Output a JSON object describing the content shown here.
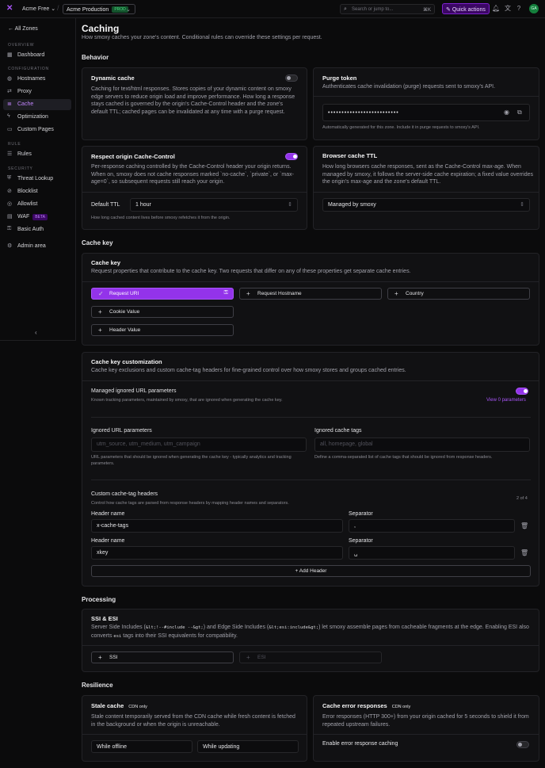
{
  "topbar": {
    "account": "Acme Free",
    "zone": "Acme Production",
    "zone_badge": "PROD",
    "search_placeholder": "Search or jump to...",
    "search_kbd": "⌘K",
    "quick_actions": "Quick actions",
    "avatar": "GA"
  },
  "sidebar": {
    "back": "All Zones",
    "sections": {
      "overview": "OVERVIEW",
      "configuration": "CONFIGURATION",
      "rule": "RULE",
      "security": "SECURITY"
    },
    "items": {
      "dashboard": "Dashboard",
      "hostnames": "Hostnames",
      "proxy": "Proxy",
      "cache": "Cache",
      "optimization": "Optimization",
      "custom_pages": "Custom Pages",
      "rules": "Rules",
      "threat_lookup": "Threat Lookup",
      "blocklist": "Blocklist",
      "allowlist": "Allowlist",
      "waf": "WAF",
      "waf_badge": "BETA",
      "basic_auth": "Basic Auth",
      "admin_area": "Admin area"
    }
  },
  "page": {
    "title": "Caching",
    "subtitle": "How smoxy caches your zone's content. Conditional rules can override these settings per request."
  },
  "behavior": {
    "heading": "Behavior",
    "dynamic": {
      "title": "Dynamic cache",
      "desc": "Caching for text/html responses. Stores copies of your dynamic content on smoxy edge servers to reduce origin load and improve performance. How long a response stays cached is governed by the origin's Cache-Control header and the zone's default TTL; cached pages can be invalidated at any time with a purge request.",
      "enabled": false
    },
    "purge": {
      "title": "Purge token",
      "desc": "Authenticates cache invalidation (purge) requests sent to smoxy's API.",
      "value": "••••••••••••••••••••••••••",
      "help": "Automatically generated for this zone. Include it in purge requests to smoxy's API."
    },
    "origin_cc": {
      "title": "Respect origin Cache-Control",
      "desc": "Per-response caching controlled by the Cache-Control header your origin returns. When on, smoxy does not cache responses marked `no-cache`, `private`, or `max-age=0`, so subsequent requests still reach your origin.",
      "enabled": true,
      "ttl_label": "Default TTL",
      "ttl_value": "1 hour",
      "ttl_help": "How long cached content lives before smoxy refetches it from the origin."
    },
    "browser_ttl": {
      "title": "Browser cache TTL",
      "desc": "How long browsers cache responses, sent as the Cache-Control max-age. When managed by smoxy, it follows the server-side cache expiration; a fixed value overrides the origin's max-age and the zone's default TTL.",
      "value": "Managed by smoxy"
    }
  },
  "cachekey": {
    "heading": "Cache key",
    "title": "Cache key",
    "desc": "Request properties that contribute to the cache key. Two requests that differ on any of these properties get separate cache entries.",
    "buttons": {
      "request_uri": "Request URI",
      "request_hostname": "Request Hostname",
      "country": "Country",
      "cookie_value": "Cookie Value",
      "header_value": "Header Value"
    }
  },
  "custom": {
    "title": "Cache key customization",
    "desc": "Cache key exclusions and custom cache-tag headers for fine-grained control over how smoxy stores and groups cached entries.",
    "managed_title": "Managed ignored URL parameters",
    "managed_desc": "Known tracking parameters, maintained by smoxy, that are ignored when generating the cache key.",
    "managed_link": "View 0 parameters",
    "managed_enabled": true,
    "ignored_params_label": "Ignored URL parameters",
    "ignored_params_placeholder": "utm_source, utm_medium, utm_campaign",
    "ignored_params_help": "URL parameters that should be ignored when generating the cache key - typically analytics and tracking parameters.",
    "ignored_tags_label": "Ignored cache tags",
    "ignored_tags_placeholder": "all, homepage, global",
    "ignored_tags_help": "Define a comma-separated list of cache tags that should be ignored from response headers.",
    "headers_title": "Custom cache-tag headers",
    "headers_desc": "Control how cache tags are parsed from response headers by mapping header names and separators.",
    "headers_count": "2 of 4",
    "rows": [
      {
        "name_label": "Header name",
        "name": "x-cache-tags",
        "sep_label": "Separator",
        "sep": ","
      },
      {
        "name_label": "Header name",
        "name": "xkey",
        "sep_label": "Separator",
        "sep": "␣"
      }
    ],
    "add": "Add Header"
  },
  "processing": {
    "heading": "Processing",
    "title": "SSI & ESI",
    "desc_a": "Server Side Includes (",
    "code1": "&lt;!--#include --&gt;",
    "desc_b": ") and Edge Side Includes (",
    "code2": "&lt;esi:include&gt;",
    "desc_c": ") let smoxy assemble pages from cacheable fragments at the edge. Enabling ESI also converts ",
    "code3": "esi",
    "desc_d": " tags into their SSI equivalents for compatibility.",
    "ssi": "SSI",
    "esi": "ESI"
  },
  "resilience": {
    "heading": "Resilience",
    "stale": {
      "title": "Stale cache",
      "badge": "CDN only",
      "desc": "Stale content temporarily served from the CDN cache while fresh content is fetched in the background or when the origin is unreachable.",
      "opt1": "While offline",
      "opt2": "While updating"
    },
    "errors": {
      "title": "Cache error responses",
      "badge": "CDN only",
      "desc": "Error responses (HTTP 300+) from your origin cached for 5 seconds to shield it from repeated upstream failures.",
      "toggle_label": "Enable error response caching",
      "enabled": false
    }
  }
}
